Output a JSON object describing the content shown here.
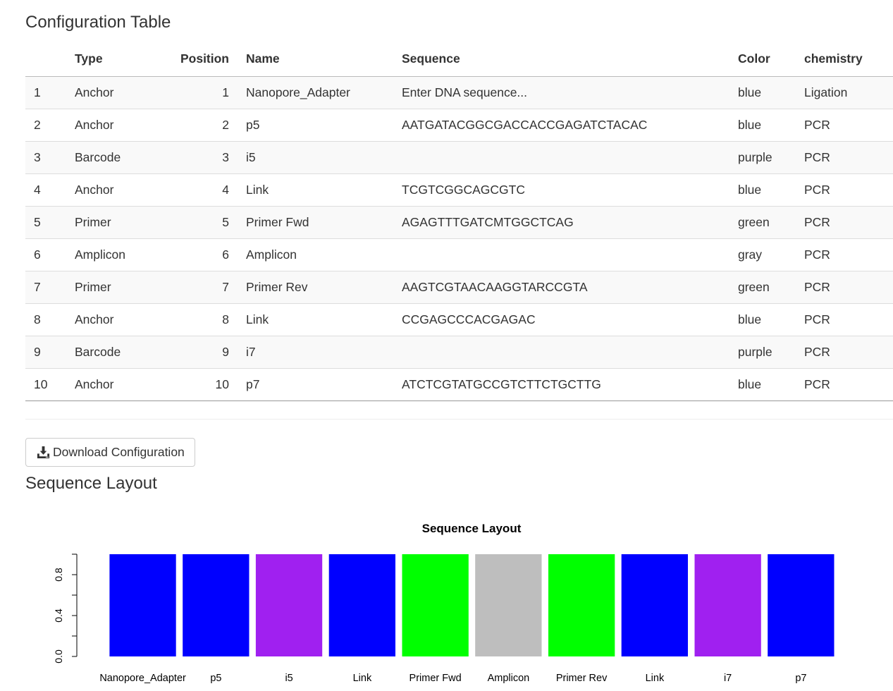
{
  "config": {
    "title": "Configuration Table",
    "columns": {
      "index": "",
      "type": "Type",
      "position": "Position",
      "name": "Name",
      "sequence": "Sequence",
      "color": "Color",
      "chemistry": "chemistry"
    },
    "rows": [
      {
        "index": "1",
        "type": "Anchor",
        "position": "1",
        "name": "Nanopore_Adapter",
        "sequence": "Enter DNA sequence...",
        "color": "blue",
        "chemistry": "Ligation"
      },
      {
        "index": "2",
        "type": "Anchor",
        "position": "2",
        "name": "p5",
        "sequence": "AATGATACGGCGACCACCGAGATCTACAC",
        "color": "blue",
        "chemistry": "PCR"
      },
      {
        "index": "3",
        "type": "Barcode",
        "position": "3",
        "name": "i5",
        "sequence": "",
        "color": "purple",
        "chemistry": "PCR"
      },
      {
        "index": "4",
        "type": "Anchor",
        "position": "4",
        "name": "Link",
        "sequence": "TCGTCGGCAGCGTC",
        "color": "blue",
        "chemistry": "PCR"
      },
      {
        "index": "5",
        "type": "Primer",
        "position": "5",
        "name": "Primer Fwd",
        "sequence": "AGAGTTTGATCMTGGCTCAG",
        "color": "green",
        "chemistry": "PCR"
      },
      {
        "index": "6",
        "type": "Amplicon",
        "position": "6",
        "name": "Amplicon",
        "sequence": "",
        "color": "gray",
        "chemistry": "PCR"
      },
      {
        "index": "7",
        "type": "Primer",
        "position": "7",
        "name": "Primer Rev",
        "sequence": "AAGTCGTAACAAGGTARCCGTA",
        "color": "green",
        "chemistry": "PCR"
      },
      {
        "index": "8",
        "type": "Anchor",
        "position": "8",
        "name": "Link",
        "sequence": "CCGAGCCCACGAGAC",
        "color": "blue",
        "chemistry": "PCR"
      },
      {
        "index": "9",
        "type": "Barcode",
        "position": "9",
        "name": "i7",
        "sequence": "",
        "color": "purple",
        "chemistry": "PCR"
      },
      {
        "index": "10",
        "type": "Anchor",
        "position": "10",
        "name": "p7",
        "sequence": "ATCTCGTATGCCGTCTTCTGCTTG",
        "color": "blue",
        "chemistry": "PCR"
      }
    ]
  },
  "download": {
    "label": "Download Configuration",
    "icon": "download-icon"
  },
  "layout": {
    "title": "Sequence Layout"
  },
  "colors": {
    "blue": "#0000ff",
    "purple": "#a020f0",
    "green": "#00ff00",
    "gray": "#bebebe"
  },
  "chart_data": {
    "type": "bar",
    "title": "Sequence Layout",
    "xlabel": "",
    "ylabel": "",
    "categories": [
      "Nanopore_Adapter",
      "p5",
      "i5",
      "Link",
      "Primer Fwd",
      "Amplicon",
      "Primer Rev",
      "Link",
      "i7",
      "p7"
    ],
    "values": [
      1,
      1,
      1,
      1,
      1,
      1,
      1,
      1,
      1,
      1
    ],
    "bar_colors": [
      "#0000ff",
      "#0000ff",
      "#a020f0",
      "#0000ff",
      "#00ff00",
      "#bebebe",
      "#00ff00",
      "#0000ff",
      "#a020f0",
      "#0000ff"
    ],
    "ylim": [
      0,
      1
    ],
    "yticks": [
      0.0,
      0.4,
      0.8
    ],
    "ytick_labels": [
      "0.0",
      "0.4",
      "0.8"
    ],
    "grid": false,
    "legend": false
  }
}
